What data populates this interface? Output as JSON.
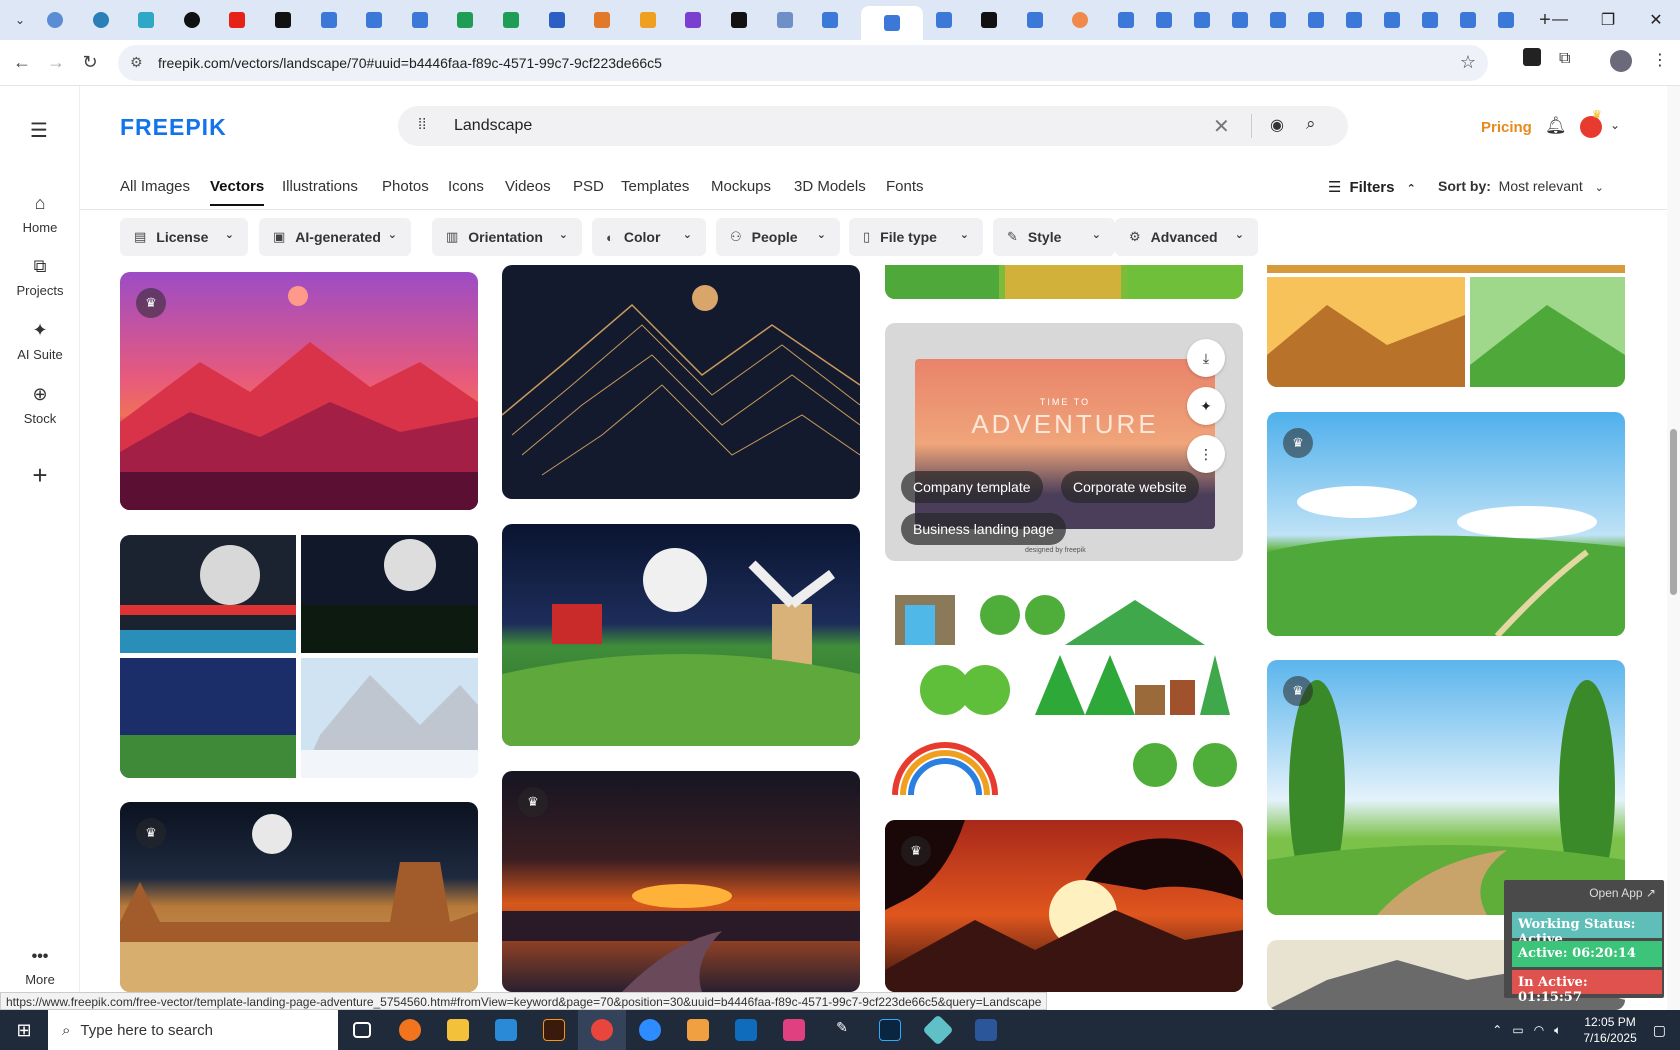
{
  "browser": {
    "url": "freepik.com/vectors/landscape/70#uuid=b4446faa-f89c-4571-99c7-9cf223de66c5",
    "status_url": "https://www.freepik.com/free-vector/template-landing-page-adventure_5754560.htm#fromView=keyword&page=70&position=30&uuid=b4446faa-f89c-4571-99c7-9cf223de66c5&query=Landscape"
  },
  "header": {
    "logo": "FREEPIK",
    "search_value": "Landscape",
    "pricing": "Pricing"
  },
  "sidebar": {
    "items": [
      {
        "label": "Home",
        "icon": "home-icon"
      },
      {
        "label": "Projects",
        "icon": "projects-icon"
      },
      {
        "label": "AI Suite",
        "icon": "sparkle-icon"
      },
      {
        "label": "Stock",
        "icon": "stock-icon"
      }
    ],
    "more": "More"
  },
  "categories": [
    "All Images",
    "Vectors",
    "Illustrations",
    "Photos",
    "Icons",
    "Videos",
    "PSD",
    "Templates",
    "Mockups",
    "3D Models",
    "Fonts"
  ],
  "active_category": "Vectors",
  "toolbar": {
    "filters_label": "Filters",
    "sort_label": "Sort by:",
    "sort_value": "Most relevant"
  },
  "filters": [
    "License",
    "AI-generated",
    "Orientation",
    "Color",
    "People",
    "File type",
    "Style",
    "Advanced"
  ],
  "hover_card": {
    "title_small": "TIME TO",
    "title_big": "ADVENTURE",
    "tags": [
      "Company template",
      "Corporate website",
      "Business landing page"
    ],
    "credit": "designed by freepik"
  },
  "widget": {
    "open_app": "Open App ↗",
    "working": "Working Status: Active",
    "active": "Active: 06:20:14",
    "inactive": "In Active: 01:15:57"
  },
  "taskbar": {
    "search_placeholder": "Type here to search",
    "time": "12:05 PM",
    "date": "7/16/2025"
  },
  "colors": {
    "brand": "#1273eb",
    "pricing": "#e8891b",
    "widget_green": "#3cc47a",
    "widget_red": "#e0524d",
    "widget_teal": "#5fbfb8"
  }
}
